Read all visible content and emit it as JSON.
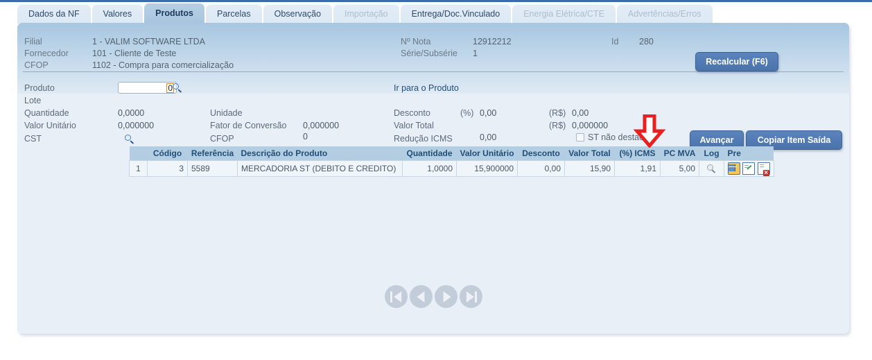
{
  "tabs": [
    {
      "label": "Dados da NF",
      "state": "normal"
    },
    {
      "label": "Valores",
      "state": "normal"
    },
    {
      "label": "Produtos",
      "state": "active"
    },
    {
      "label": "Parcelas",
      "state": "normal"
    },
    {
      "label": "Observação",
      "state": "normal"
    },
    {
      "label": "Importação",
      "state": "disabled"
    },
    {
      "label": "Entrega/Doc.Vinculado",
      "state": "normal"
    },
    {
      "label": "Energia Elétrica/CTE",
      "state": "disabled"
    },
    {
      "label": "Advertências/Erros",
      "state": "disabled"
    }
  ],
  "header": {
    "filial_label": "Filial",
    "filial_value": "1 - VALIM SOFTWARE LTDA",
    "fornecedor_label": "Fornecedor",
    "fornecedor_value": "101 - Cliente de Teste",
    "cfop_label": "CFOP",
    "cfop_value": "1102 - Compra para comercialização",
    "num_nota_label": "Nº Nota",
    "num_nota_value": "12912212",
    "serie_label": "Série/Subsérie",
    "serie_value": "1",
    "id_label": "Id",
    "id_value": "280",
    "recalcular_button": "Recalcular (F6)"
  },
  "form": {
    "produto_label": "Produto",
    "produto_value": "0",
    "produto_search_icon": "search-icon",
    "lote_label": "Lote",
    "lote_value": "",
    "quantidade_label": "Quantidade",
    "quantidade_value": "0,0000",
    "valor_unitario_label": "Valor Unitário",
    "valor_unitario_value": "0,000000",
    "cst_label": "CST",
    "cst_search_icon": "search-icon",
    "unidade_label": "Unidade",
    "unidade_value": "",
    "fator_label": "Fator de Conversão",
    "fator_value": "0,000000",
    "cfop_label": "CFOP",
    "cfop_value": "0",
    "ir_para_produto_link": "Ir para o Produto",
    "desconto_label": "Desconto",
    "desconto_pct_unit": "(%)",
    "desconto_pct_value": "0,00",
    "desconto_rs_unit": "(R$)",
    "desconto_rs_value": "0,00",
    "valor_total_label": "Valor Total",
    "valor_total_rs_unit": "(R$)",
    "valor_total_rs_value": "0,000000",
    "reducao_icms_label": "Redução ICMS",
    "reducao_icms_value": "0,00",
    "st_checkbox_label": "ST não destac.",
    "st_checkbox_checked": false,
    "avancar_button": "Avançar",
    "copiar_button": "Copiar Item Saída"
  },
  "grid": {
    "columns": [
      "",
      "Código",
      "Referência",
      "Descrição do Produto",
      "Quantidade",
      "Valor Unitário",
      "Desconto",
      "Valor Total",
      "(%) ICMS",
      "PC MVA",
      "Log",
      "Pre"
    ],
    "rows": [
      {
        "index": "1",
        "codigo": "3",
        "referencia": "5589",
        "descricao": "MERCADORIA ST (DEBITO E CREDITO)",
        "quantidade": "1,0000",
        "valor_unitario": "15,900000",
        "desconto": "0,00",
        "valor_total": "15,90",
        "icms_pct": "1,91",
        "pc_mva": "5,00",
        "icons": [
          "magnifier-disabled-icon",
          "grid-icon",
          "edit-icon",
          "delete-icon"
        ]
      }
    ]
  },
  "pagination": {
    "first_label": "first-page",
    "prev_label": "previous-page",
    "next_label": "next-page",
    "last_label": "last-page"
  },
  "annotation": {
    "arrow": "red-down-arrow",
    "color": "#e8201f"
  },
  "colors": {
    "accent": "#4a72ab",
    "tab_active": "#b6cfe4",
    "panel_bg": "#e8eff7",
    "grid_header": "#b3cde2",
    "link": "#1f4e79"
  }
}
